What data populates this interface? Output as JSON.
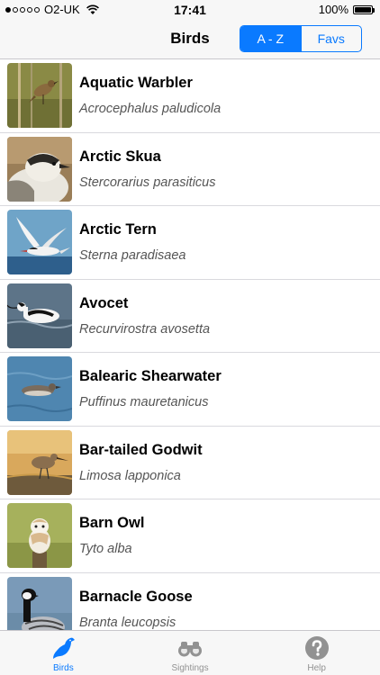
{
  "status_bar": {
    "carrier": "O2-UK",
    "time": "17:41",
    "battery_text": "100%",
    "signal_dots_filled": 1,
    "signal_dots_total": 5
  },
  "nav": {
    "title": "Birds",
    "segments": [
      {
        "label": "A - Z",
        "selected": true
      },
      {
        "label": "Favs",
        "selected": false
      }
    ]
  },
  "birds": [
    {
      "name": "Aquatic Warbler",
      "latin": "Acrocephalus paludicola",
      "photo": "aquatic-warbler-photo"
    },
    {
      "name": "Arctic Skua",
      "latin": "Stercorarius parasiticus",
      "photo": "arctic-skua-photo"
    },
    {
      "name": "Arctic Tern",
      "latin": "Sterna paradisaea",
      "photo": "arctic-tern-photo"
    },
    {
      "name": "Avocet",
      "latin": "Recurvirostra avosetta",
      "photo": "avocet-photo"
    },
    {
      "name": "Balearic Shearwater",
      "latin": "Puffinus mauretanicus",
      "photo": "balearic-shearwater-photo"
    },
    {
      "name": "Bar-tailed Godwit",
      "latin": "Limosa lapponica",
      "photo": "bar-tailed-godwit-photo"
    },
    {
      "name": "Barn Owl",
      "latin": "Tyto alba",
      "photo": "barn-owl-photo"
    },
    {
      "name": "Barnacle Goose",
      "latin": "Branta leucopsis",
      "photo": "barnacle-goose-photo"
    }
  ],
  "tabs": [
    {
      "label": "Birds",
      "icon": "bird-icon",
      "active": true
    },
    {
      "label": "Sightings",
      "icon": "binoculars-icon",
      "active": false
    },
    {
      "label": "Help",
      "icon": "help-icon",
      "active": false
    }
  ],
  "colors": {
    "accent": "#0a7aff",
    "tab_inactive": "#929292"
  }
}
